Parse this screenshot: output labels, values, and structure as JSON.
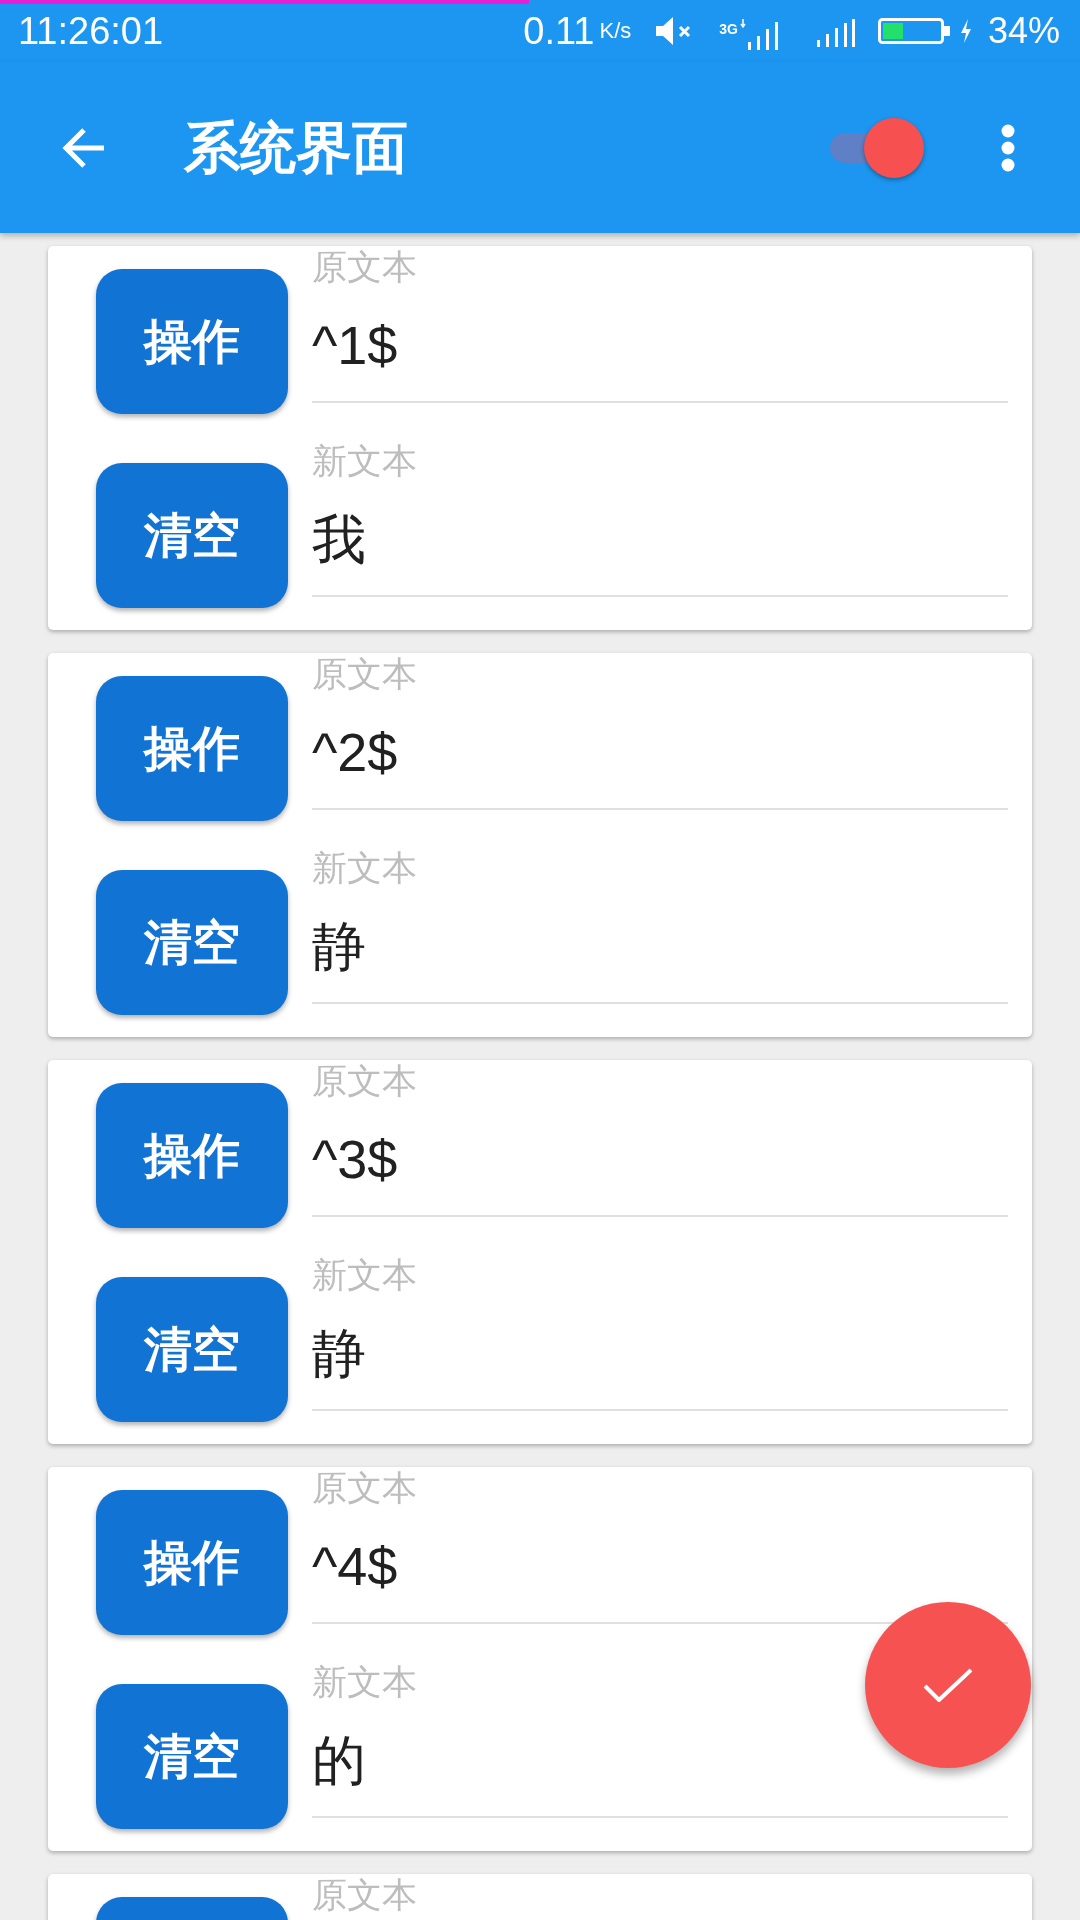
{
  "top_progress": {
    "level": 0.49
  },
  "status_bar": {
    "time": "11:26:01",
    "speed": "0.11",
    "speed_unit": "K/s",
    "network_type": "3G",
    "battery_percent": "34%"
  },
  "app_bar": {
    "title": "系统界面",
    "switch": {
      "on": true
    }
  },
  "cards": [
    {
      "rows": [
        {
          "button": "操作",
          "label": "原文本",
          "value": "^1$"
        },
        {
          "button": "清空",
          "label": "新文本",
          "value": "我"
        }
      ]
    },
    {
      "rows": [
        {
          "button": "操作",
          "label": "原文本",
          "value": "^2$"
        },
        {
          "button": "清空",
          "label": "新文本",
          "value": "静"
        }
      ]
    },
    {
      "rows": [
        {
          "button": "操作",
          "label": "原文本",
          "value": "^3$"
        },
        {
          "button": "清空",
          "label": "新文本",
          "value": "静"
        }
      ]
    },
    {
      "rows": [
        {
          "button": "操作",
          "label": "原文本",
          "value": "^4$"
        },
        {
          "button": "清空",
          "label": "新文本",
          "value": "的"
        }
      ]
    },
    {
      "rows": [
        {
          "label": "原文本"
        }
      ]
    }
  ]
}
